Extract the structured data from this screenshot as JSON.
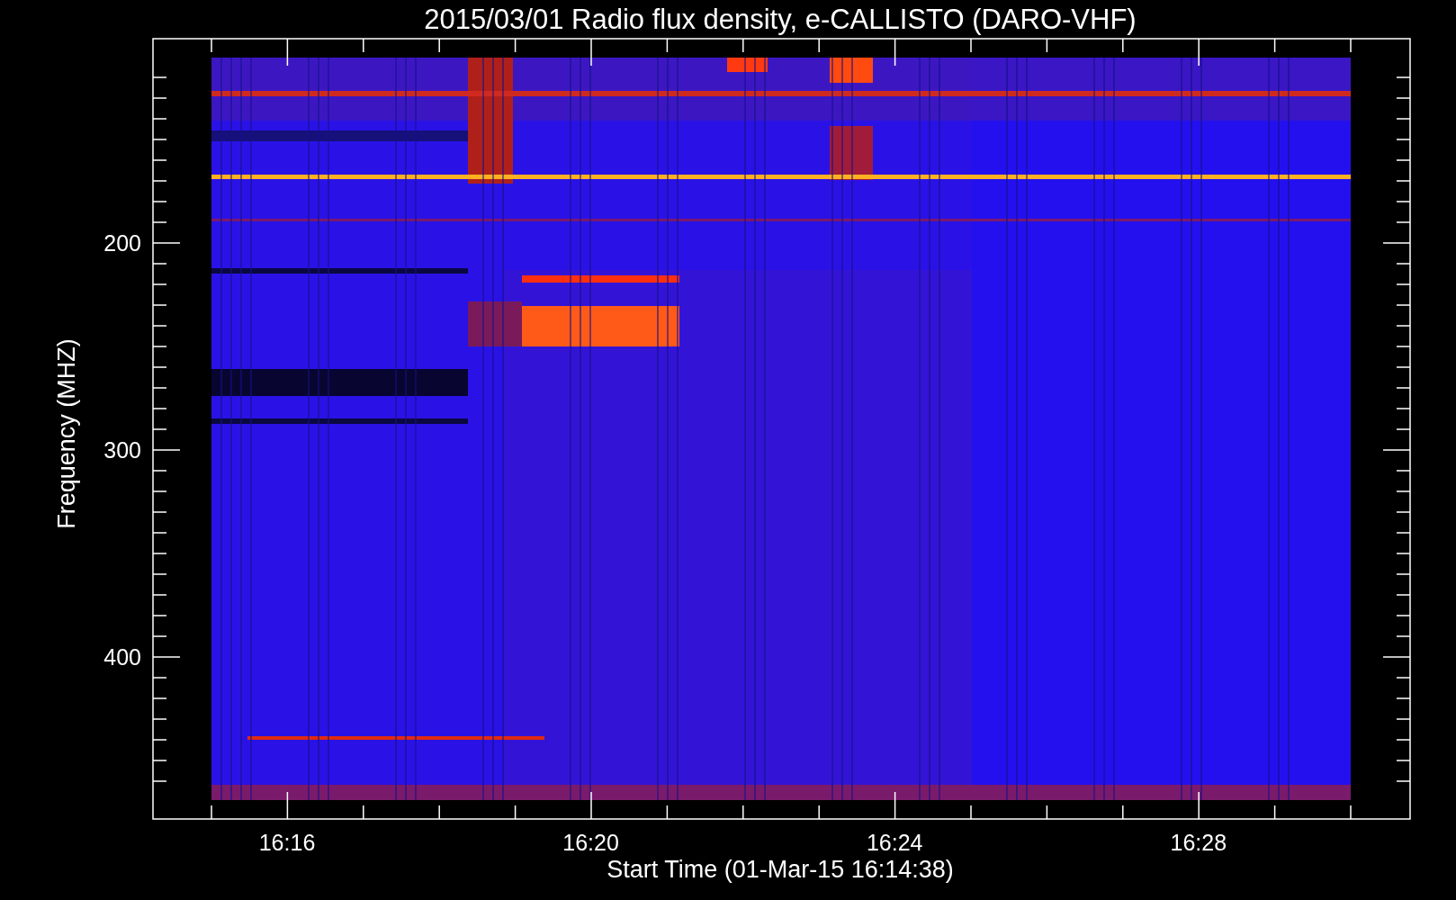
{
  "title": "2015/03/01  Radio flux density, e-CALLISTO (DARO-VHF)",
  "y_axis": {
    "label": "Frequency (MHZ)",
    "ticks": [
      "200",
      "300",
      "400"
    ]
  },
  "x_axis": {
    "label": "Start Time (01-Mar-15 16:14:38)",
    "ticks": [
      "16:16",
      "16:20",
      "16:24",
      "16:28"
    ]
  }
}
